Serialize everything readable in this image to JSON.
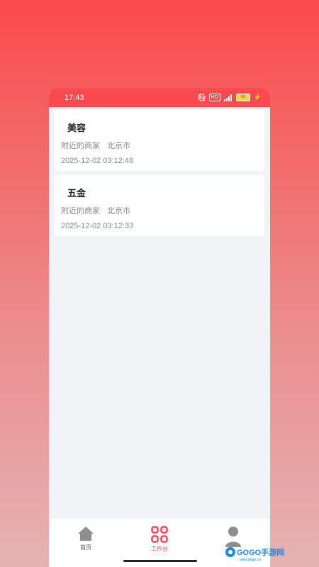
{
  "status_bar": {
    "time": "17:43",
    "hd_label": "HD",
    "battery": "88"
  },
  "records": [
    {
      "title": "美容",
      "category": "附近的商家",
      "city": "北京市",
      "timestamp": "2025-12-02 03:12:48"
    },
    {
      "title": "五金",
      "category": "附近的商家",
      "city": "北京市",
      "timestamp": "2025-12-02 03:12:33"
    }
  ],
  "tabs": [
    {
      "label": "首页",
      "icon": "home-icon",
      "active": false
    },
    {
      "label": "工作台",
      "icon": "grid-icon",
      "active": true
    },
    {
      "label": "",
      "icon": "user-icon",
      "active": false
    }
  ],
  "watermark": {
    "brand": "GOGO手游网",
    "domain": "www.gogo.cn"
  },
  "colors": {
    "accent": "#f0465a",
    "status_bar": "#fa4a50",
    "list_bg": "#f2f3f7"
  }
}
